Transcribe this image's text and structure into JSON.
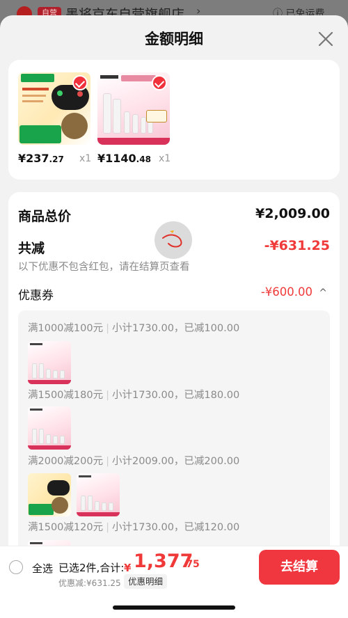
{
  "background": {
    "badge": "自营",
    "store_name": "墨将京东自营旗舰店",
    "store_arrow": "›",
    "shipping_text": "已免运费"
  },
  "sheet": {
    "title": "金额明细"
  },
  "products": [
    {
      "name": "gamepad",
      "price_int": "¥237",
      "price_dec": ".27",
      "qty": "x1"
    },
    {
      "name": "lancome-set",
      "price_int": "¥1140",
      "price_dec": ".48",
      "qty": "x1"
    }
  ],
  "breakdown": {
    "total_label": "商品总价",
    "total_value": "¥2,009.00",
    "discount_label": "共减",
    "discount_value": "-¥631.25",
    "note": "以下优惠不包含红包，请在结算页查看",
    "coupon_label": "优惠券",
    "coupon_value": "-¥600.00",
    "coupon_toggle": "^"
  },
  "coupons": [
    {
      "rule": "满1000减100元",
      "detail": "小计1730.00，已减100.00"
    },
    {
      "rule": "满1500减180元",
      "detail": "小计1730.00，已减180.00"
    },
    {
      "rule": "满2000减200元",
      "detail": "小计2009.00，已减200.00"
    },
    {
      "rule": "满1500减120元",
      "detail": "小计1730.00，已减120.00"
    }
  ],
  "bottom": {
    "select_all": "全选",
    "selected_count": "已选2件,合计:",
    "currency": "¥",
    "total_int": "1,377",
    "total_dec": ".75",
    "discount_note": "优惠减:¥631.25",
    "detail_button": "优惠明细",
    "checkout": "去结算"
  },
  "colors": {
    "accent": "#f03a3a",
    "sheet_bg": "#f2f2f2"
  }
}
